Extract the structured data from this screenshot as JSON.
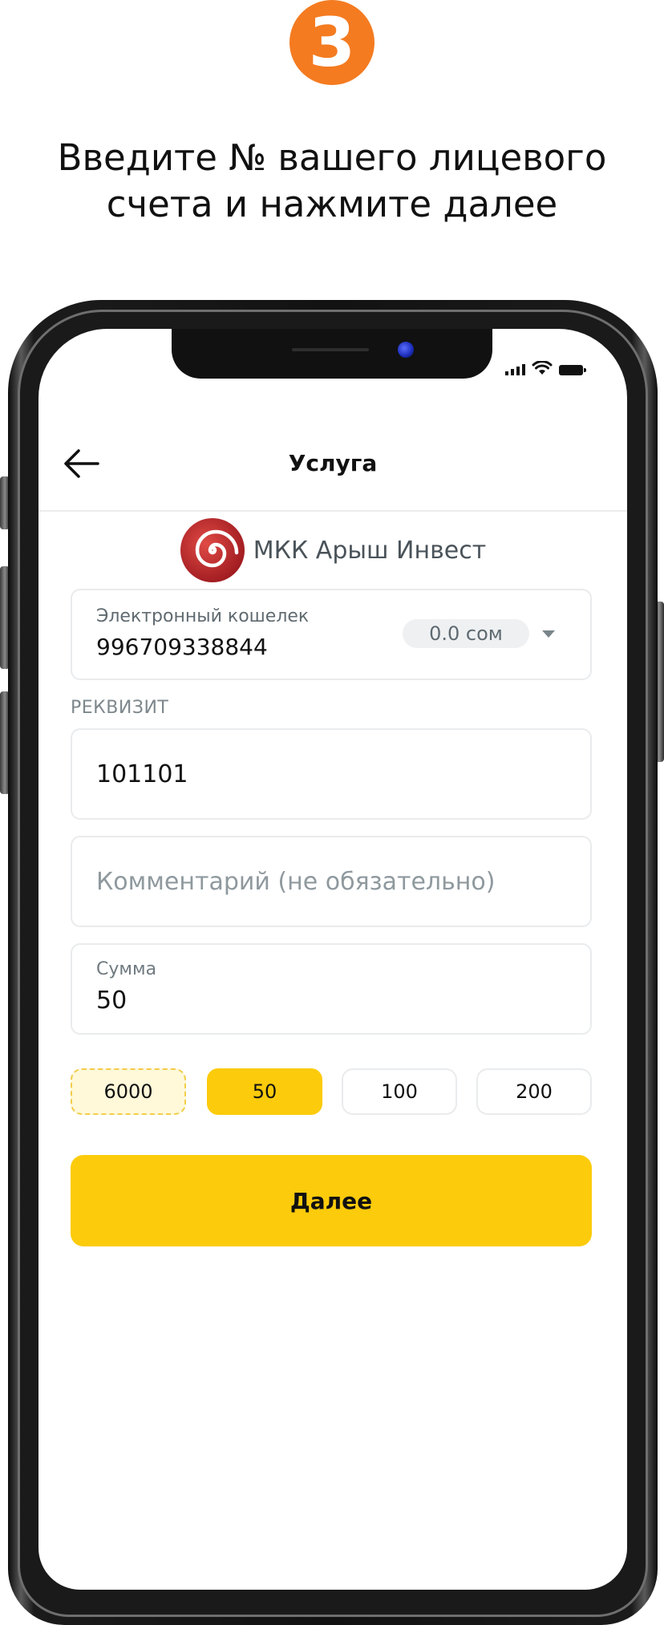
{
  "instruction": {
    "step_number": "3",
    "line1": "Введите № вашего лицевого",
    "line2": "счета и нажмите далее"
  },
  "status_bar": {
    "icons": [
      "signal-icon",
      "wifi-icon",
      "battery-icon"
    ]
  },
  "header": {
    "back_icon": "arrow-left-icon",
    "title": "Услуга"
  },
  "provider": {
    "logo_icon": "spiral-logo-icon",
    "name": "МКК Арыш Инвест"
  },
  "wallet": {
    "label": "Электронный кошелек",
    "number": "996709338844",
    "balance": "0.0 сом",
    "dropdown_icon": "caret-down-icon"
  },
  "form": {
    "requisite_label": "РЕКВИЗИТ",
    "requisite_value": "101101",
    "comment_placeholder": "Комментарий (не обязательно)",
    "amount_label": "Сумма",
    "amount_value": "50"
  },
  "amount_chips": [
    {
      "label": "6000",
      "state": "suggested"
    },
    {
      "label": "50",
      "state": "selected"
    },
    {
      "label": "100",
      "state": "default"
    },
    {
      "label": "200",
      "state": "default"
    }
  ],
  "actions": {
    "next_label": "Далее"
  },
  "colors": {
    "step_badge": "#f47b20",
    "accent_yellow": "#fccb0b",
    "logo_red": "#c8262c",
    "muted_text": "#7d878c"
  }
}
